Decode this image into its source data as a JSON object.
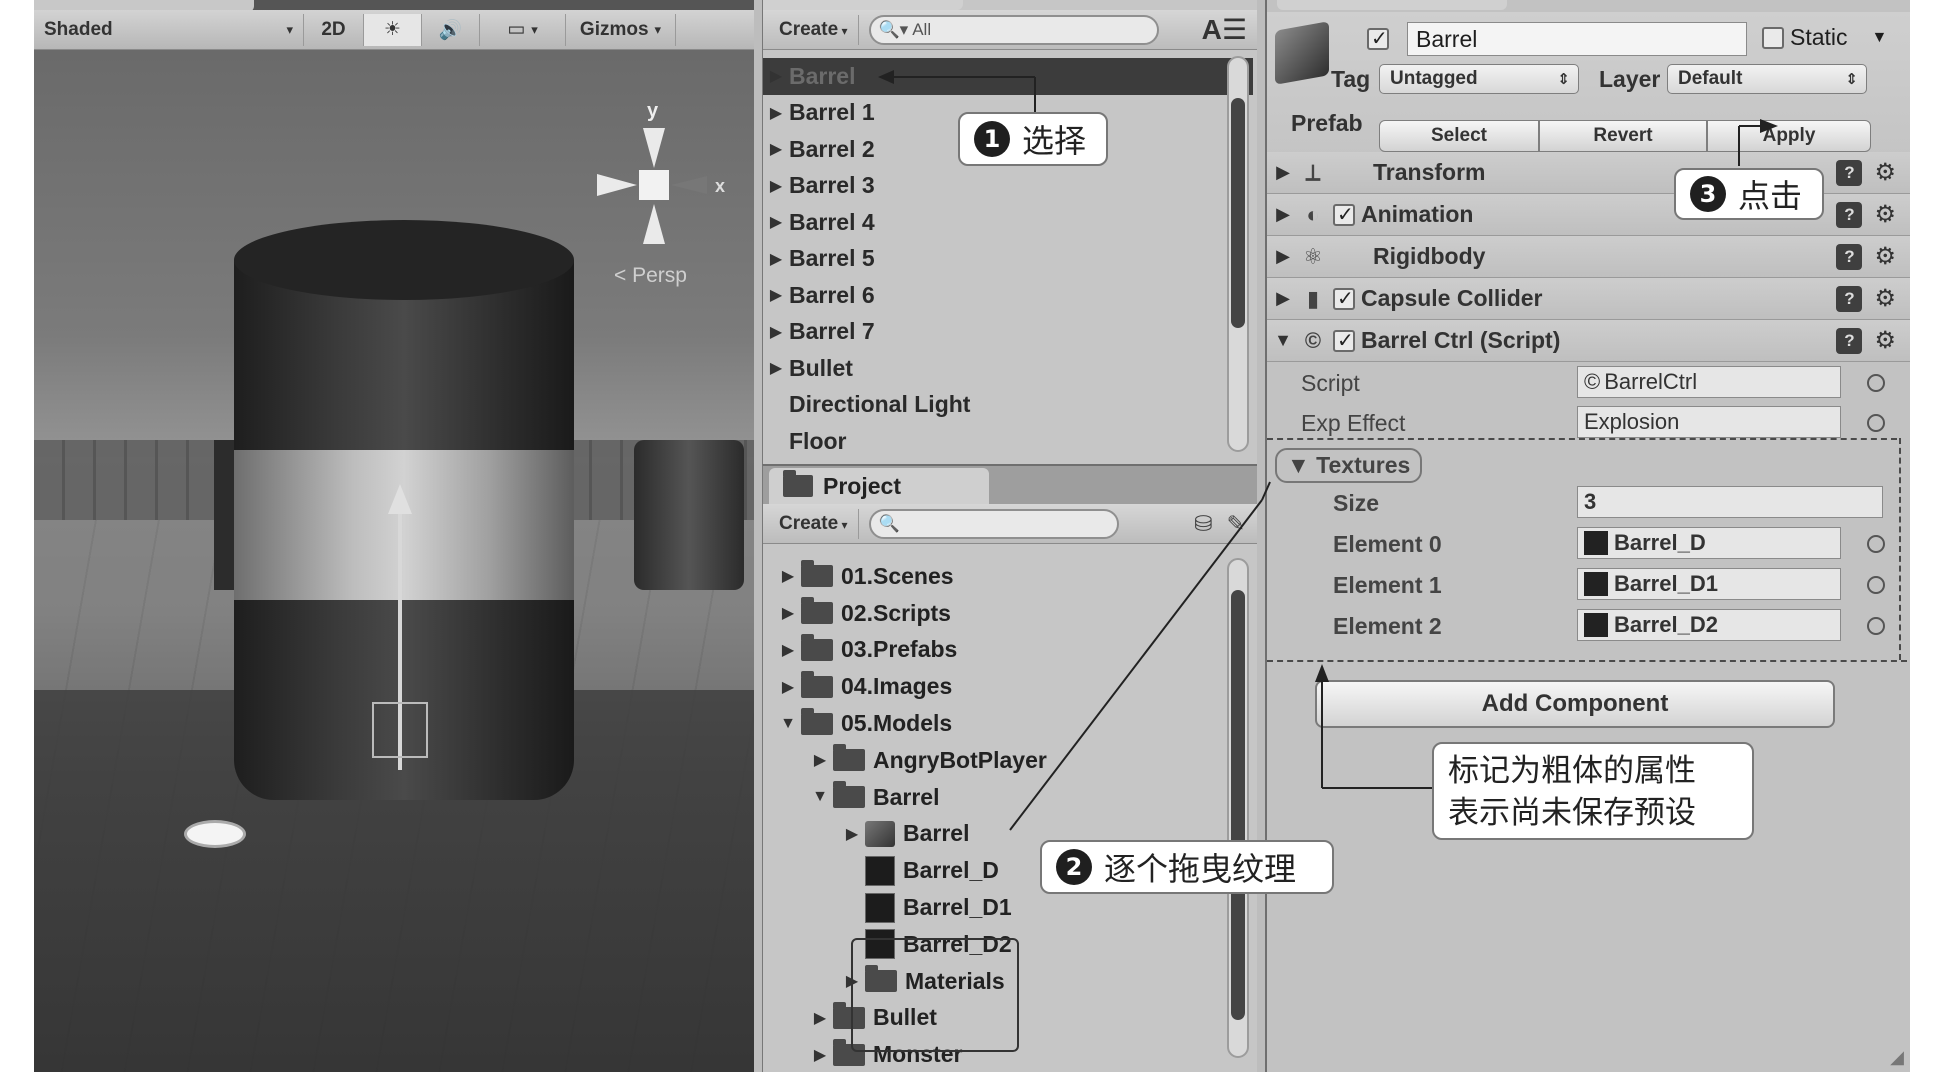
{
  "scene": {
    "toolbar": {
      "shading": "Shaded",
      "mode2d": "2D",
      "gizmos": "Gizmos"
    },
    "gizmo": {
      "y_label": "y",
      "x_label": "x",
      "persp_label": "< Persp"
    }
  },
  "hierarchy": {
    "create_label": "Create",
    "search_placeholder": "All",
    "items": [
      {
        "label": "Barrel",
        "selected": true
      },
      {
        "label": "Barrel 1"
      },
      {
        "label": "Barrel 2"
      },
      {
        "label": "Barrel 3"
      },
      {
        "label": "Barrel 4"
      },
      {
        "label": "Barrel 5"
      },
      {
        "label": "Barrel 6"
      },
      {
        "label": "Barrel 7"
      },
      {
        "label": "Bullet"
      },
      {
        "label": "Directional Light"
      },
      {
        "label": "Floor"
      }
    ]
  },
  "project": {
    "tab_label": "Project",
    "create_label": "Create",
    "items": [
      {
        "label": "01.Scenes"
      },
      {
        "label": "02.Scripts"
      },
      {
        "label": "03.Prefabs"
      },
      {
        "label": "04.Images"
      },
      {
        "label": "05.Models"
      },
      {
        "label": "AngryBotPlayer"
      },
      {
        "label": "Barrel"
      },
      {
        "label": "Barrel"
      },
      {
        "label": "Barrel_D"
      },
      {
        "label": "Barrel_D1"
      },
      {
        "label": "Barrel_D2"
      },
      {
        "label": "Materials"
      },
      {
        "label": "Bullet"
      },
      {
        "label": "Monster"
      }
    ]
  },
  "inspector": {
    "object_name": "Barrel",
    "static_label": "Static",
    "tag_label": "Tag",
    "tag_value": "Untagged",
    "layer_label": "Layer",
    "layer_value": "Default",
    "prefab_label": "Prefab",
    "prefab_select": "Select",
    "prefab_revert": "Revert",
    "prefab_apply": "Apply",
    "components": {
      "transform": "Transform",
      "animation": "Animation",
      "rigidbody": "Rigidbody",
      "capsule_collider": "Capsule Collider",
      "barrel_ctrl": "Barrel Ctrl (Script)"
    },
    "props": {
      "script_label": "Script",
      "script_value": "BarrelCtrl",
      "exp_effect_label": "Exp Effect",
      "exp_effect_value": "Explosion",
      "textures_label": "Textures",
      "size_label": "Size",
      "size_value": "3",
      "element0_label": "Element 0",
      "element0_value": "Barrel_D",
      "element1_label": "Element 1",
      "element1_value": "Barrel_D1",
      "element2_label": "Element 2",
      "element2_value": "Barrel_D2"
    },
    "add_component": "Add Component"
  },
  "callouts": {
    "step1": {
      "num": "1",
      "text": "选择"
    },
    "step2": {
      "num": "2",
      "text": "逐个拖曳纹理"
    },
    "step3": {
      "num": "3",
      "text": "点击"
    },
    "note_line1": "标记为粗体的属性",
    "note_line2": "表示尚未保存预设"
  }
}
